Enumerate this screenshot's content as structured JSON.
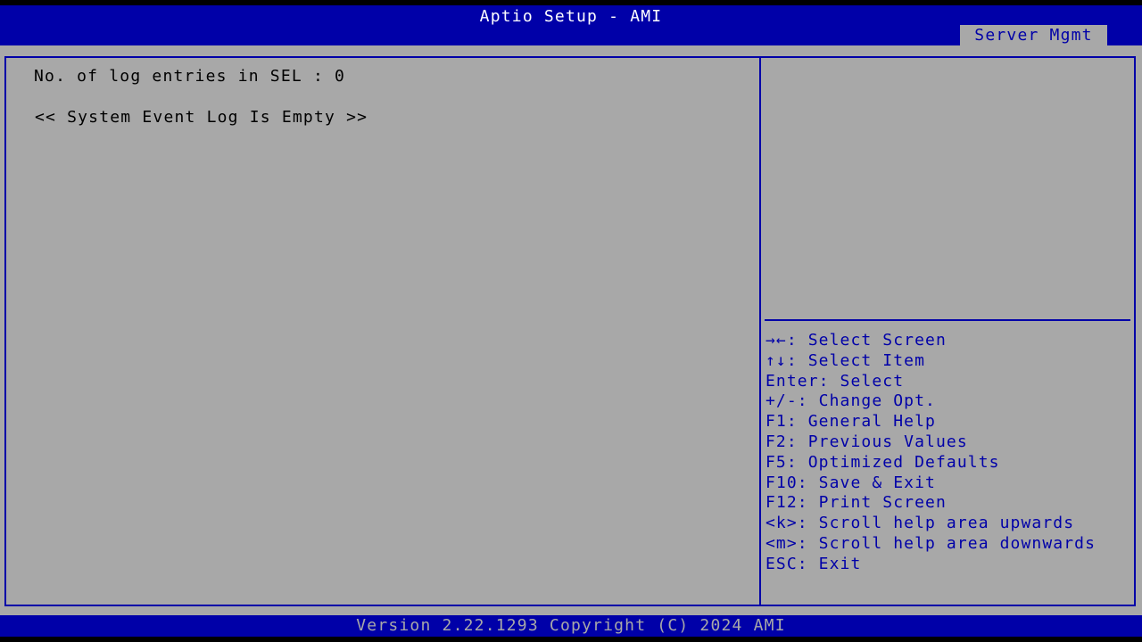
{
  "header": {
    "title": "Aptio Setup - AMI",
    "active_tab": "Server Mgmt"
  },
  "main": {
    "log_count_line": "No. of log entries in SEL : 0",
    "empty_message": "<< System Event Log Is Empty >>"
  },
  "help": {
    "keys": [
      "→←: Select Screen",
      "↑↓: Select Item",
      "Enter: Select",
      "+/-: Change Opt.",
      "F1: General Help",
      "F2: Previous Values",
      "F5: Optimized Defaults",
      "F10: Save & Exit",
      "F12: Print Screen",
      "<k>: Scroll help area upwards",
      "<m>: Scroll help area downwards",
      "ESC: Exit"
    ]
  },
  "footer": {
    "version": "Version 2.22.1293 Copyright (C) 2024 AMI"
  },
  "colors": {
    "header_blue": "#0000a8",
    "panel_gray": "#a8a8a8",
    "text_black": "#000000",
    "text_white": "#ffffff"
  }
}
